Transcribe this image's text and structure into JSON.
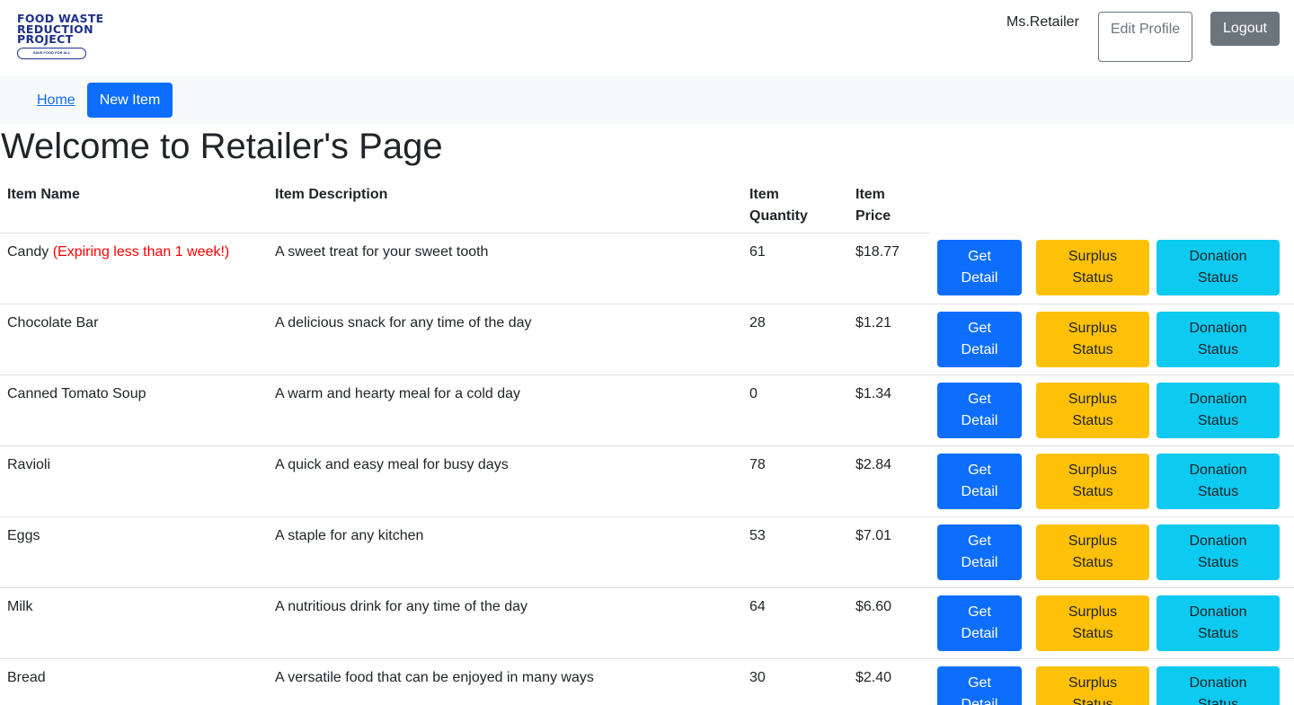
{
  "logo": {
    "lines": [
      "FOOD WASTE",
      "REDUCTION",
      "PROJECT"
    ],
    "tagline": "SAVE FOOD FOR ALL"
  },
  "header": {
    "username": "Ms.Retailer",
    "edit_profile_label": "Edit Profile",
    "logout_label": "Logout"
  },
  "nav": {
    "home_label": "Home",
    "new_item_label": "New Item"
  },
  "page_title": "Welcome to Retailer's Page",
  "table": {
    "headers": {
      "name": "Item Name",
      "description": "Item Description",
      "quantity": "Item Quantity",
      "price": "Item Price"
    },
    "buttons": {
      "detail": "Get Detail",
      "surplus": "Surplus Status",
      "donation": "Donation Status"
    },
    "rows": [
      {
        "name": "Candy",
        "warning": "(Expiring less than 1 week!)",
        "description": "A sweet treat for your sweet tooth",
        "quantity": "61",
        "price": "$18.77"
      },
      {
        "name": "Chocolate Bar",
        "warning": "",
        "description": "A delicious snack for any time of the day",
        "quantity": "28",
        "price": "$1.21"
      },
      {
        "name": "Canned Tomato Soup",
        "warning": "",
        "description": "A warm and hearty meal for a cold day",
        "quantity": "0",
        "price": "$1.34"
      },
      {
        "name": "Ravioli",
        "warning": "",
        "description": "A quick and easy meal for busy days",
        "quantity": "78",
        "price": "$2.84"
      },
      {
        "name": "Eggs",
        "warning": "",
        "description": "A staple for any kitchen",
        "quantity": "53",
        "price": "$7.01"
      },
      {
        "name": "Milk",
        "warning": "",
        "description": "A nutritious drink for any time of the day",
        "quantity": "64",
        "price": "$6.60"
      },
      {
        "name": "Bread",
        "warning": "",
        "description": "A versatile food that can be enjoyed in many ways",
        "quantity": "30",
        "price": "$2.40"
      }
    ]
  }
}
